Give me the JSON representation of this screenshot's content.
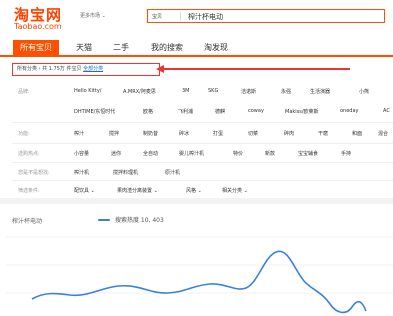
{
  "header": {
    "logo_cn": "淘宝网",
    "logo_en": "Taobao.com",
    "more_market": "更多市场 ⌄",
    "search_category": "宝贝",
    "search_query": "榨汁杯电动"
  },
  "tabs": [
    {
      "label": "所有宝贝",
      "active": true
    },
    {
      "label": "天猫"
    },
    {
      "label": "二手"
    },
    {
      "label": "我的搜索"
    },
    {
      "label": "淘发现"
    }
  ],
  "breadcrumb": {
    "prefix": "所有分类 › 共 1.75万 件宝贝",
    "link": "全部分类",
    "accent_color": "#ee3333"
  },
  "filters": [
    {
      "label": "品牌:",
      "rows": [
        [
          "Hello Kitty/",
          "A.MRX/阿麦思",
          "3M",
          "SKG",
          "洁诺斯",
          "永强",
          "生活演器",
          "小熊"
        ],
        [
          "DHTIME/东恒时代",
          "欧格",
          "飞利浦",
          "德麒",
          "coway",
          "Makiss/欧莱斯",
          "oneday",
          "AC"
        ]
      ]
    },
    {
      "label": "功能:",
      "rows": [
        [
          "榨汁",
          "搅拌",
          "制奶昔",
          "碎冰",
          "打蛋",
          "切菜",
          "碎肉",
          "干磨",
          "和面",
          "混合"
        ]
      ]
    },
    {
      "label": "选购热点:",
      "rows": [
        [
          "小容量",
          "迷你",
          "全自动",
          "婴儿榨汁机",
          "特价",
          "新款",
          "宝宝辅食",
          "手持"
        ]
      ]
    },
    {
      "label": "您是不是想找:",
      "rows": [
        [
          "榨汁机",
          "搅拌料理机",
          "原汁机"
        ]
      ]
    },
    {
      "label": "筛选条件:",
      "rows": [
        [
          "配饮具 ⌄",
          "果肉渣分离装置 ⌄",
          "风格 ⌄",
          "相关分类 ⌄"
        ]
      ]
    }
  ],
  "trend": {
    "title": "榨汁杯电动",
    "legend": "搜索热度 10, 403",
    "line_color": "#3a80e0"
  }
}
